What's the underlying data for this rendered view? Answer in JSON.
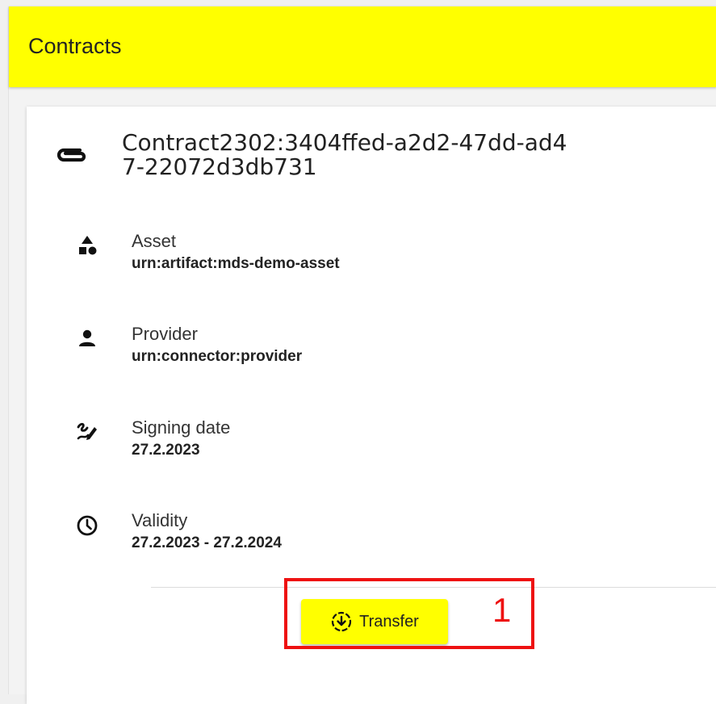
{
  "header": {
    "title": "Contracts"
  },
  "contract": {
    "title": "Contract2302:3404ffed-a2d2-47dd-ad47-22072d3db731",
    "icon": "paperclip-icon"
  },
  "details": [
    {
      "label": "Asset",
      "value": "urn:artifact:mds-demo-asset",
      "icon": "shapes-icon"
    },
    {
      "label": "Provider",
      "value": "urn:connector:provider",
      "icon": "person-icon"
    },
    {
      "label": "Signing date",
      "value": "27.2.2023",
      "icon": "signature-icon"
    },
    {
      "label": "Validity",
      "value": "27.2.2023 - 27.2.2024",
      "icon": "clock-icon"
    }
  ],
  "actions": {
    "transfer_label": "Transfer",
    "transfer_icon": "download-circle-icon"
  },
  "annotation": {
    "number": "1",
    "color": "#ee1111"
  },
  "colors": {
    "accent": "#ffff00",
    "background": "#f3f3f3",
    "card": "#ffffff"
  }
}
